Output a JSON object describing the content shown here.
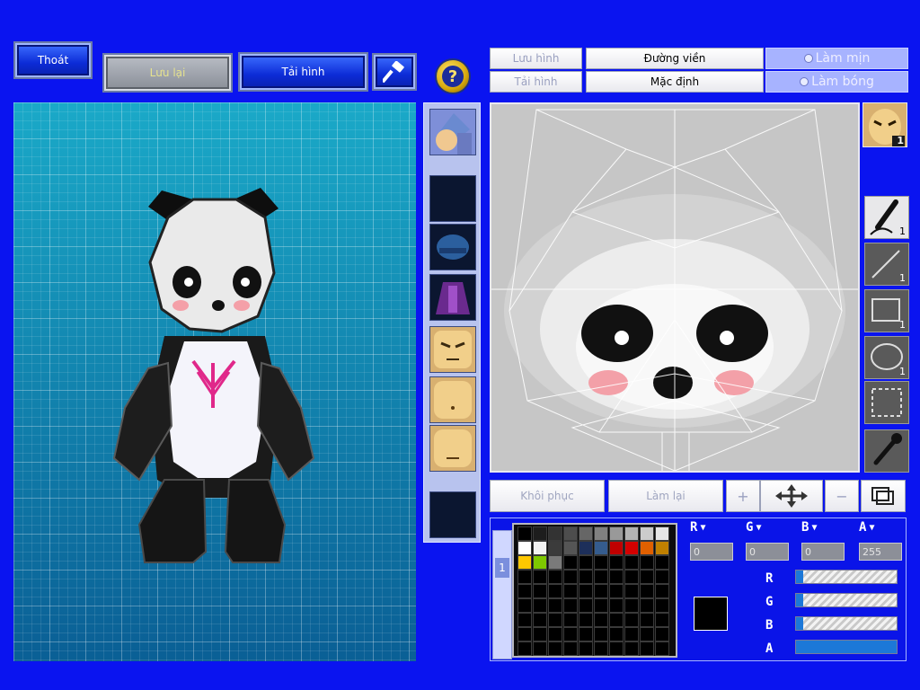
{
  "header": {
    "exit_label": "Thoát",
    "save_label": "Lưu lại",
    "reload_label": "Tải hình",
    "hammer_icon": "hammer-icon",
    "help_icon": "help-icon"
  },
  "editor_tabs": {
    "save_image": "Lưu hình",
    "load_image": "Tải hình",
    "outline": "Đường viền",
    "default": "Mặc định",
    "smooth": "Làm mịn",
    "shade": "Làm bóng"
  },
  "parts": {
    "items": [
      "wizard-head-part",
      "empty-slot",
      "helmet-part",
      "purple-armor-part",
      "angry-face-part",
      "round-face-part",
      "plain-face-part",
      "empty-slot"
    ]
  },
  "tools": {
    "items": [
      {
        "name": "pen-tool",
        "count": "1"
      },
      {
        "name": "line-tool",
        "count": "1"
      },
      {
        "name": "rectangle-tool",
        "count": "1"
      },
      {
        "name": "ellipse-tool",
        "count": "1"
      },
      {
        "name": "selection-tool",
        "count": ""
      },
      {
        "name": "eyedropper-tool",
        "count": ""
      }
    ],
    "face_badge": "1"
  },
  "actions": {
    "restore": "Khôi phục",
    "redo": "Làm lại",
    "add": "+",
    "minus": "−"
  },
  "color": {
    "current": "#000000",
    "channels": [
      {
        "label": "R",
        "value": "0"
      },
      {
        "label": "G",
        "value": "0"
      },
      {
        "label": "B",
        "value": "0"
      },
      {
        "label": "A",
        "value": "255"
      }
    ],
    "sliders": [
      {
        "label": "R",
        "fraction": 0.0
      },
      {
        "label": "G",
        "fraction": 0.0
      },
      {
        "label": "B",
        "fraction": 0.0
      },
      {
        "label": "A",
        "fraction": 1.0
      }
    ],
    "swatches_row1": [
      "#000000",
      "#1d1d1d",
      "#333333",
      "#4d4d4d",
      "#666666",
      "#808080",
      "#999999",
      "#b3b3b3",
      "#cccccc",
      "#e6e6e6"
    ],
    "swatches_row2": [
      "#ffffff",
      "#f2f2f2",
      "#3b3b3b",
      "#555555",
      "#1d2f5a",
      "#355c8e",
      "#c00000",
      "#d40000",
      "#e06000",
      "#c08000"
    ],
    "swatches_row3": [
      "#ffc800",
      "#7ec800",
      "#7a7a7a"
    ],
    "palette_tab": "1"
  },
  "colors": {
    "background": "#0a14f0",
    "preview_grid": "#1486b6",
    "editor_bg": "#c7c7c7",
    "accent_pink": "#e0288a"
  }
}
